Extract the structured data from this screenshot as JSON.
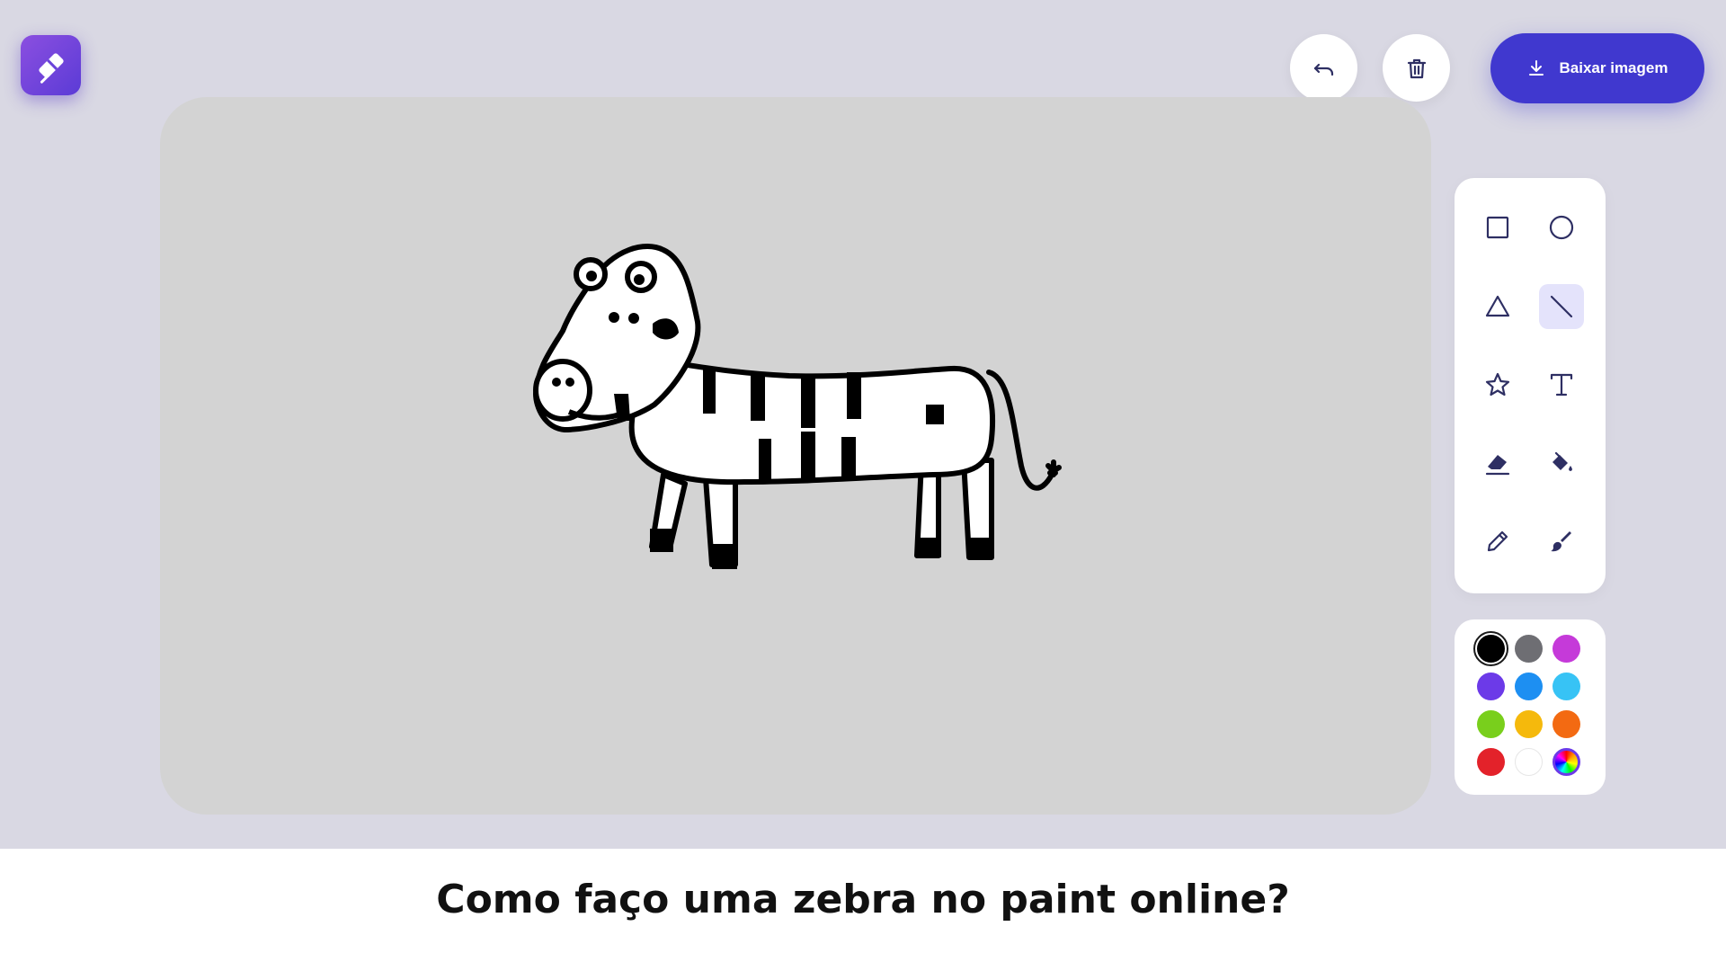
{
  "toolbar": {
    "undo_icon": "undo-icon",
    "delete_icon": "trash-icon",
    "download_label": "Baixar imagem",
    "download_icon": "download-icon",
    "accent_color": "#4038cf"
  },
  "logo": {
    "icon": "eraser-logo-icon"
  },
  "tools": [
    {
      "name": "rectangle",
      "icon": "square-icon",
      "active": false
    },
    {
      "name": "circle",
      "icon": "circle-icon",
      "active": false
    },
    {
      "name": "triangle",
      "icon": "triangle-icon",
      "active": false
    },
    {
      "name": "line",
      "icon": "line-icon",
      "active": true
    },
    {
      "name": "star",
      "icon": "star-icon",
      "active": false
    },
    {
      "name": "text",
      "icon": "text-icon",
      "active": false
    },
    {
      "name": "eraser",
      "icon": "eraser-icon",
      "active": false
    },
    {
      "name": "fill",
      "icon": "paint-bucket-icon",
      "active": false
    },
    {
      "name": "pencil",
      "icon": "pencil-icon",
      "active": false
    },
    {
      "name": "brush",
      "icon": "brush-icon",
      "active": false
    }
  ],
  "colors": [
    {
      "name": "black",
      "hex": "#000000",
      "selected": true
    },
    {
      "name": "gray",
      "hex": "#6e6e73",
      "selected": false
    },
    {
      "name": "magenta",
      "hex": "#c53ad9",
      "selected": false
    },
    {
      "name": "violet",
      "hex": "#6c3ae8",
      "selected": false
    },
    {
      "name": "blue",
      "hex": "#1d8ff2",
      "selected": false
    },
    {
      "name": "cyan",
      "hex": "#37c3f5",
      "selected": false
    },
    {
      "name": "green",
      "hex": "#79cf1c",
      "selected": false
    },
    {
      "name": "yellow",
      "hex": "#f5b90c",
      "selected": false
    },
    {
      "name": "orange",
      "hex": "#f36a12",
      "selected": false
    },
    {
      "name": "red",
      "hex": "#e3222a",
      "selected": false
    },
    {
      "name": "white",
      "hex": "#ffffff",
      "selected": false
    },
    {
      "name": "rainbow",
      "hex": "conic",
      "selected": false
    }
  ],
  "canvas": {
    "background": "#d3d3d3",
    "drawing": "zebra-drawing"
  },
  "footer": {
    "question": "Como faço uma zebra no paint online?"
  }
}
